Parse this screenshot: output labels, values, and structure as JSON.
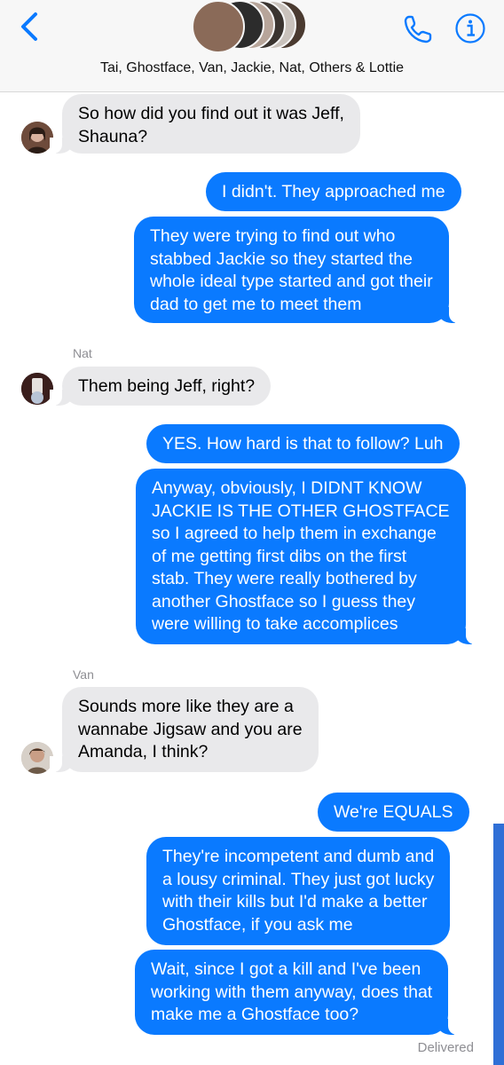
{
  "header": {
    "group_name": "Tai, Ghostface, Van, Jackie, Nat, Others & Lottie",
    "avatar_colors": [
      "#8a6a58",
      "#2c2c2c",
      "#b7a59a",
      "#3a3430",
      "#c9c2bc",
      "#4a3a30"
    ]
  },
  "colors": {
    "accent": "#0a7aff",
    "incoming": "#e9e9eb",
    "meta": "#8e8e93"
  },
  "messages": [
    {
      "id": "m1",
      "direction": "in",
      "sender": "Shauna-avatar",
      "lines": [
        "So how did you find out it was Jeff,",
        "Shauna?"
      ]
    },
    {
      "id": "m2",
      "direction": "out",
      "lines": [
        "I didn't. They approached me"
      ]
    },
    {
      "id": "m3",
      "direction": "out",
      "lines": [
        "They were trying to find out who",
        "stabbed Jackie so they started the",
        "whole ideal type started and got their",
        "dad to get me to meet them"
      ]
    },
    {
      "id": "m4",
      "direction": "in",
      "sender_name": "Nat",
      "lines": [
        "Them being Jeff, right?"
      ]
    },
    {
      "id": "m5",
      "direction": "out",
      "lines": [
        "YES. How hard is that to follow? Luh"
      ]
    },
    {
      "id": "m6",
      "direction": "out",
      "lines": [
        "Anyway, obviously, I DIDNT KNOW",
        "JACKIE IS THE OTHER GHOSTFACE",
        "so I agreed to help them in exchange",
        "of me getting first dibs on the first",
        "stab. They were really bothered by",
        "another Ghostface so I guess they",
        "were willing to take accomplices"
      ]
    },
    {
      "id": "m7",
      "direction": "in",
      "sender_name": "Van",
      "lines": [
        "Sounds more like they are a",
        "wannabe Jigsaw and you are",
        "Amanda, I think?"
      ]
    },
    {
      "id": "m8",
      "direction": "out",
      "lines": [
        "We're EQUALS"
      ]
    },
    {
      "id": "m9",
      "direction": "out",
      "lines": [
        "They're incompetent and dumb and",
        "a lousy criminal. They just got lucky",
        "with their kills but I'd make a better",
        "Ghostface, if you ask me"
      ]
    },
    {
      "id": "m10",
      "direction": "out",
      "lines": [
        "Wait, since I got a kill and I've been",
        "working with them anyway, does that",
        "make me a Ghostface too?"
      ]
    }
  ],
  "status": {
    "delivered": "Delivered"
  }
}
